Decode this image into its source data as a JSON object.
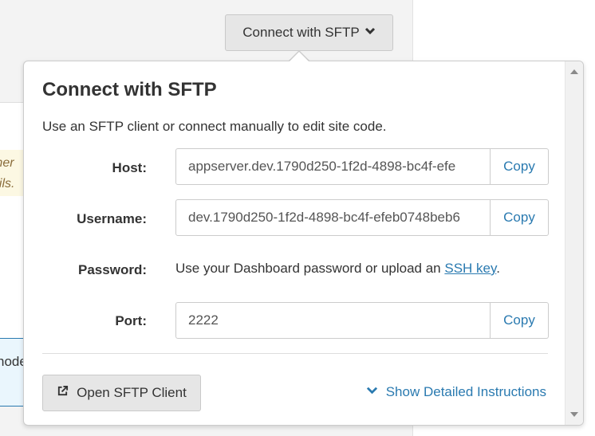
{
  "background": {
    "warning_lines": [
      "mer",
      "ails."
    ],
    "info_text": "node"
  },
  "trigger": {
    "label": "Connect with SFTP",
    "icon": "chevron-down-icon"
  },
  "popover": {
    "title": "Connect with SFTP",
    "description": "Use an SFTP client or connect manually to edit site code.",
    "fields": {
      "host": {
        "label": "Host:",
        "value": "appserver.dev.1790d250-1f2d-4898-bc4f-efe",
        "copy_label": "Copy"
      },
      "username": {
        "label": "Username:",
        "value": "dev.1790d250-1f2d-4898-bc4f-efeb0748beb6",
        "copy_label": "Copy"
      },
      "password": {
        "label": "Password:",
        "text_before": "Use your Dashboard password or upload an ",
        "link": "SSH key",
        "text_after": "."
      },
      "port": {
        "label": "Port:",
        "value": "2222",
        "copy_label": "Copy"
      }
    },
    "open_button": {
      "label": "Open SFTP Client",
      "icon": "external-link-icon"
    },
    "show_link": {
      "label": "Show Detailed Instructions",
      "icon": "chevron-down-icon"
    }
  },
  "colors": {
    "link": "#2a7ab0",
    "button_bg": "#e6e6e6",
    "info_bg": "#eaf6fd",
    "warning_bg": "#fcf8e3"
  }
}
